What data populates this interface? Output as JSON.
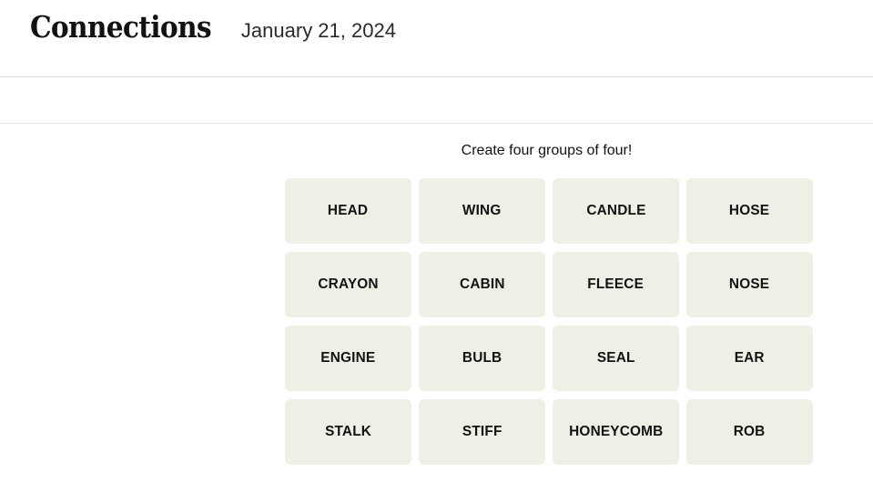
{
  "header": {
    "game_title": "Connections",
    "date": "January 21, 2024"
  },
  "board": {
    "instructions": "Create four groups of four!",
    "tiles": [
      {
        "label": "HEAD"
      },
      {
        "label": "WING"
      },
      {
        "label": "CANDLE"
      },
      {
        "label": "HOSE"
      },
      {
        "label": "CRAYON"
      },
      {
        "label": "CABIN"
      },
      {
        "label": "FLEECE"
      },
      {
        "label": "NOSE"
      },
      {
        "label": "ENGINE"
      },
      {
        "label": "BULB"
      },
      {
        "label": "SEAL"
      },
      {
        "label": "EAR"
      },
      {
        "label": "STALK"
      },
      {
        "label": "STIFF"
      },
      {
        "label": "HONEYCOMB"
      },
      {
        "label": "ROB"
      }
    ]
  },
  "colors": {
    "page_background": "#ffffff",
    "tile_background": "#efefe6",
    "text": "#121212",
    "rule": "#e2e2e2"
  }
}
